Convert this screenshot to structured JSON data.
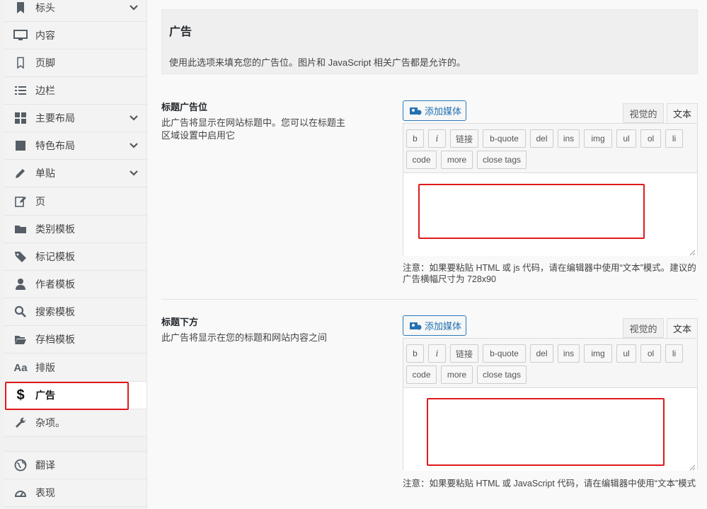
{
  "sidebar": {
    "items": [
      {
        "label": "标头",
        "icon": "bookmark-icon",
        "chevron": true
      },
      {
        "label": "内容",
        "icon": "monitor-icon",
        "chevron": false
      },
      {
        "label": "页脚",
        "icon": "bookmark-outline-icon",
        "chevron": false
      },
      {
        "label": "边栏",
        "icon": "list-icon",
        "chevron": false
      },
      {
        "label": "主要布局",
        "icon": "grid-icon",
        "chevron": true
      },
      {
        "label": "特色布局",
        "icon": "square-icon",
        "chevron": true
      },
      {
        "label": "单贴",
        "icon": "pencil-icon",
        "chevron": true
      },
      {
        "label": "页",
        "icon": "edit-page-icon",
        "chevron": false
      },
      {
        "label": "类别模板",
        "icon": "folder-icon",
        "chevron": false
      },
      {
        "label": "标记模板",
        "icon": "tag-icon",
        "chevron": false
      },
      {
        "label": "作者模板",
        "icon": "user-icon",
        "chevron": false
      },
      {
        "label": "搜索模板",
        "icon": "search-icon",
        "chevron": false
      },
      {
        "label": "存档模板",
        "icon": "folder-open-icon",
        "chevron": false
      },
      {
        "label": "排版",
        "icon": "typography-icon",
        "chevron": false
      },
      {
        "label": "广告",
        "icon": "dollar-icon",
        "chevron": false,
        "active": true
      },
      {
        "label": "杂项。",
        "icon": "wrench-icon",
        "chevron": false
      },
      {
        "label": "翻译",
        "icon": "globe-icon",
        "chevron": false
      },
      {
        "label": "表现",
        "icon": "dashboard-icon",
        "chevron": false
      }
    ]
  },
  "header": {
    "title": "广告",
    "description": "使用此选项来填充您的广告位。图片和 JavaScript 相关广告都是允许的。"
  },
  "sections": [
    {
      "title": "标题广告位",
      "description": "此广告将显示在网站标题中。您可以在标题主区域设置中启用它",
      "note": "注意：如果要粘贴 HTML 或 js 代码，请在编辑器中使用“文本”模式。建议的广告横幅尺寸为 728x90"
    },
    {
      "title": "标题下方",
      "description": "此广告将显示在您的标题和网站内容之间",
      "note": "注意：如果要粘贴 HTML 或 JavaScript 代码，请在编辑器中使用“文本”模式"
    }
  ],
  "editor": {
    "add_media": "添加媒体",
    "tab_visual": "视觉的",
    "tab_text": "文本",
    "quicktags_row1": [
      "b",
      "i",
      "链接",
      "b-quote",
      "del",
      "ins",
      "img",
      "ul",
      "ol",
      "li"
    ],
    "quicktags_row2": [
      "code",
      "more",
      "close tags"
    ]
  },
  "colors": {
    "highlight": "#e0191b",
    "link": "#2271b1"
  }
}
